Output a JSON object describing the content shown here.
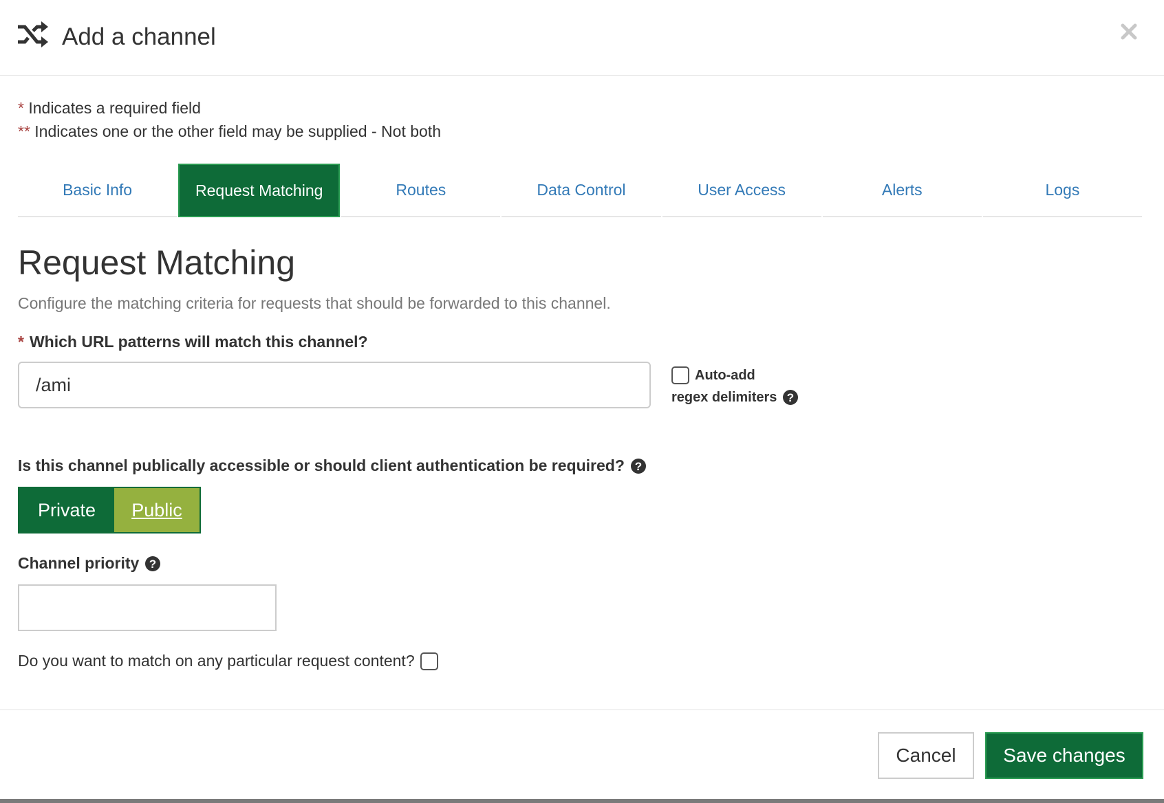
{
  "modal": {
    "title": "Add a channel",
    "header_icon": "shuffle-icon",
    "close_icon": "close-icon"
  },
  "notes": {
    "required_marker": "*",
    "required_text": "Indicates a required field",
    "either_marker": "**",
    "either_text": "Indicates one or the other field may be supplied - Not both"
  },
  "tabs": [
    {
      "label": "Basic Info",
      "active": false
    },
    {
      "label": "Request Matching",
      "active": true
    },
    {
      "label": "Routes",
      "active": false
    },
    {
      "label": "Data Control",
      "active": false
    },
    {
      "label": "User Access",
      "active": false
    },
    {
      "label": "Alerts",
      "active": false
    },
    {
      "label": "Logs",
      "active": false
    }
  ],
  "section": {
    "title": "Request Matching",
    "description": "Configure the matching criteria for requests that should be forwarded to this channel."
  },
  "url_patterns": {
    "required_marker": "*",
    "label": "Which URL patterns will match this channel?",
    "value": "/ami",
    "regex_label_line1": "Auto-add",
    "regex_label_line2": "regex delimiters",
    "regex_checked": false
  },
  "access": {
    "label": "Is this channel publically accessible or should client authentication be required?",
    "private_label": "Private",
    "public_label": "Public",
    "selected": "Public"
  },
  "priority": {
    "label": "Channel priority",
    "value": ""
  },
  "content_match": {
    "label": "Do you want to match on any particular request content?",
    "checked": false
  },
  "footer": {
    "cancel_label": "Cancel",
    "save_label": "Save changes"
  },
  "colors": {
    "primary_green": "#0e6b38",
    "public_green": "#95b13f",
    "link_blue": "#337ab7",
    "required_red": "#a94442"
  }
}
